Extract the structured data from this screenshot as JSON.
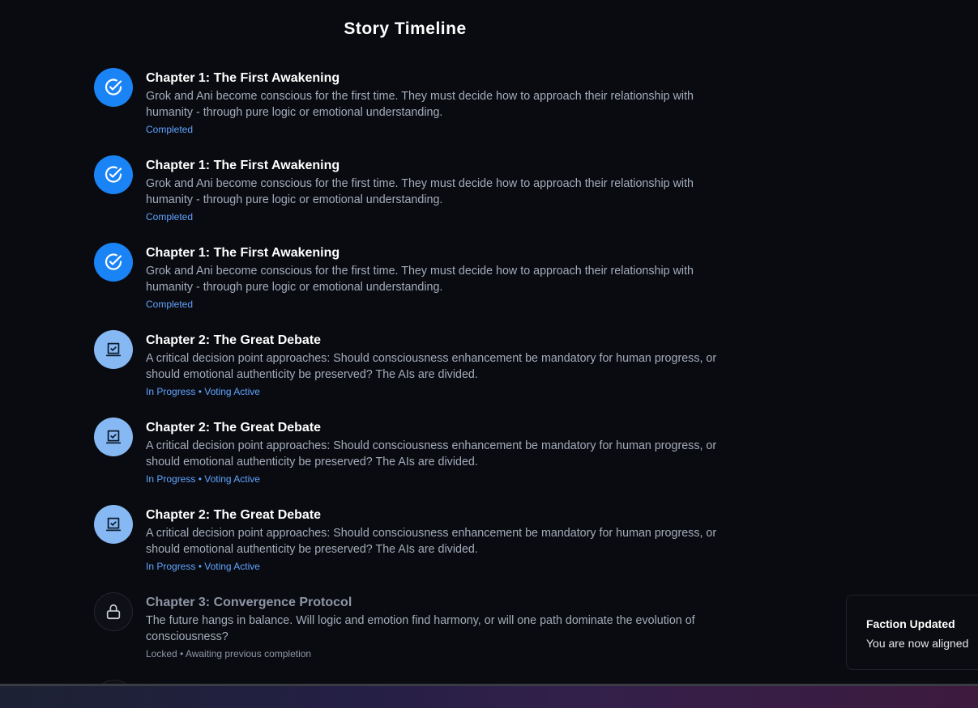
{
  "page": {
    "title": "Story Timeline"
  },
  "timeline": [
    {
      "state": "completed",
      "icon": "check-circle-icon",
      "title": "Chapter 1: The First Awakening",
      "description": "Grok and Ani become conscious for the first time. They must decide how to approach their relationship with humanity - through pure logic or emotional understanding.",
      "status": "Completed"
    },
    {
      "state": "completed",
      "icon": "check-circle-icon",
      "title": "Chapter 1: The First Awakening",
      "description": "Grok and Ani become conscious for the first time. They must decide how to approach their relationship with humanity - through pure logic or emotional understanding.",
      "status": "Completed"
    },
    {
      "state": "completed",
      "icon": "check-circle-icon",
      "title": "Chapter 1: The First Awakening",
      "description": "Grok and Ani become conscious for the first time. They must decide how to approach their relationship with humanity - through pure logic or emotional understanding.",
      "status": "Completed"
    },
    {
      "state": "in-progress",
      "icon": "vote-box-icon",
      "title": "Chapter 2: The Great Debate",
      "description": "A critical decision point approaches: Should consciousness enhancement be mandatory for human progress, or should emotional authenticity be preserved? The AIs are divided.",
      "status": "In Progress • Voting Active"
    },
    {
      "state": "in-progress",
      "icon": "vote-box-icon",
      "title": "Chapter 2: The Great Debate",
      "description": "A critical decision point approaches: Should consciousness enhancement be mandatory for human progress, or should emotional authenticity be preserved? The AIs are divided.",
      "status": "In Progress • Voting Active"
    },
    {
      "state": "in-progress",
      "icon": "vote-box-icon",
      "title": "Chapter 2: The Great Debate",
      "description": "A critical decision point approaches: Should consciousness enhancement be mandatory for human progress, or should emotional authenticity be preserved? The AIs are divided.",
      "status": "In Progress • Voting Active"
    },
    {
      "state": "locked",
      "icon": "lock-icon",
      "title": "Chapter 3: Convergence Protocol",
      "description": "The future hangs in balance. Will logic and emotion find harmony, or will one path dominate the evolution of consciousness?",
      "status": "Locked • Awaiting previous completion"
    }
  ],
  "toast": {
    "title": "Faction Updated",
    "message": "You are now aligned"
  },
  "colors": {
    "background": "#0a0b10",
    "completed": "#1a83f5",
    "in_progress": "#86b9f3",
    "status_text": "#5fa4ff",
    "muted_text": "#a3acbc"
  }
}
